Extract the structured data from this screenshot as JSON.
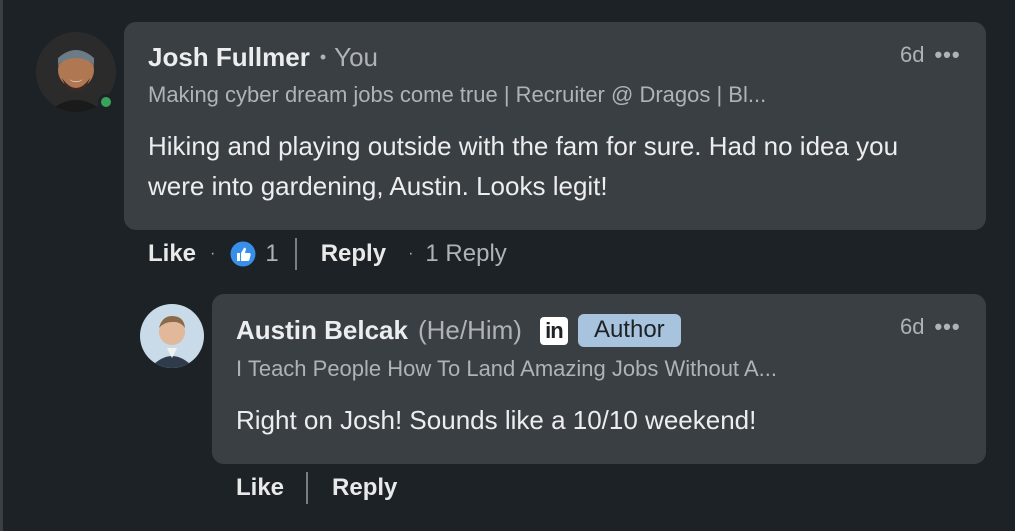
{
  "comments": [
    {
      "author": "Josh Fullmer",
      "relation": "You",
      "headline": "Making cyber dream jobs come true | Recruiter @ Dragos | Bl...",
      "time": "6d",
      "more": "•••",
      "text": "Hiking and playing outside with the fam for sure. Had no idea you were into gardening, Austin. Looks legit!",
      "actions": {
        "like": "Like",
        "reaction_count": "1",
        "reply": "Reply",
        "reply_count": "1 Reply"
      },
      "online": true
    },
    {
      "author": "Austin Belcak",
      "pronouns": "(He/Him)",
      "linkedin_badge": "in",
      "author_badge": "Author",
      "headline": "I Teach People How To Land Amazing Jobs Without A...",
      "time": "6d",
      "more": "•••",
      "text": "Right on Josh! Sounds like a 10/10 weekend!",
      "actions": {
        "like": "Like",
        "reply": "Reply"
      }
    }
  ],
  "colors": {
    "background": "#1d2226",
    "bubble": "#3a3f44",
    "author_badge": "#a8c3dd",
    "online": "#3aa35a",
    "like_reaction": "#378fe9"
  },
  "icons": {
    "more": "ellipsis-icon",
    "like_reaction": "thumbs-up-icon",
    "linkedin": "linkedin-icon"
  }
}
